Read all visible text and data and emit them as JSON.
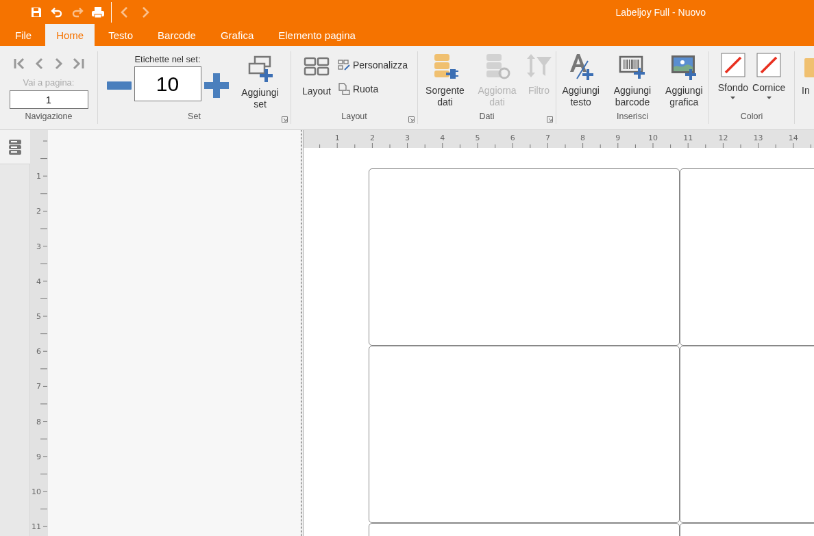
{
  "window": {
    "title": "Labeljoy Full - Nuovo"
  },
  "quick_access": [
    {
      "kind": "save",
      "disabled": false
    },
    {
      "kind": "undo",
      "disabled": false
    },
    {
      "kind": "redo",
      "disabled": true
    },
    {
      "kind": "print",
      "disabled": false
    },
    {
      "kind": "back",
      "disabled": true
    },
    {
      "kind": "forward",
      "disabled": true
    }
  ],
  "tabs": [
    {
      "label": "File",
      "selected": false
    },
    {
      "label": "Home",
      "selected": true
    },
    {
      "label": "Testo",
      "selected": false
    },
    {
      "label": "Barcode",
      "selected": false
    },
    {
      "label": "Grafica",
      "selected": false
    },
    {
      "label": "Elemento pagina",
      "selected": false
    }
  ],
  "ribbon": {
    "navigation": {
      "buttons": [
        {
          "kind": "first",
          "disabled": true
        },
        {
          "kind": "prev",
          "disabled": true
        },
        {
          "kind": "next",
          "disabled": true
        },
        {
          "kind": "last",
          "disabled": true
        }
      ],
      "go_to_label": "Vai a pagina:",
      "go_to_disabled": true,
      "page_value": "1",
      "group_label": "Navigazione"
    },
    "set": {
      "count_label": "Etichette nel set:",
      "count_value": "10",
      "add_button": "Aggiungi set",
      "group_label": "Set"
    },
    "layout": {
      "layout_button": "Layout",
      "customize_button": "Personalizza",
      "rotate_button": "Ruota",
      "group_label": "Layout"
    },
    "data": {
      "buttons": [
        {
          "kind": "source",
          "label": "Sorgente dati",
          "disabled": false
        },
        {
          "kind": "refresh",
          "label": "Aggiorna dati",
          "disabled": true
        },
        {
          "kind": "filter",
          "label": "Filtro",
          "disabled": true
        }
      ],
      "group_label": "Dati"
    },
    "insert": {
      "buttons": [
        {
          "kind": "text",
          "label": "Aggiungi testo"
        },
        {
          "kind": "barcode",
          "label": "Aggiungi barcode"
        },
        {
          "kind": "image",
          "label": "Aggiungi grafica"
        }
      ],
      "group_label": "Inserisci"
    },
    "colors": {
      "buttons": [
        {
          "label": "Sfondo"
        },
        {
          "label": "Cornice"
        }
      ],
      "group_label": "Colori"
    },
    "cut_button": "In"
  },
  "horizontal_ruler": [
    "1",
    "2",
    "3",
    "4",
    "5",
    "6",
    "7",
    "8",
    "9",
    "10",
    "11",
    "12",
    "13",
    "14"
  ],
  "vertical_ruler": [
    "1",
    "2",
    "3",
    "4",
    "5",
    "6",
    "7",
    "8",
    "9",
    "10",
    "11"
  ]
}
